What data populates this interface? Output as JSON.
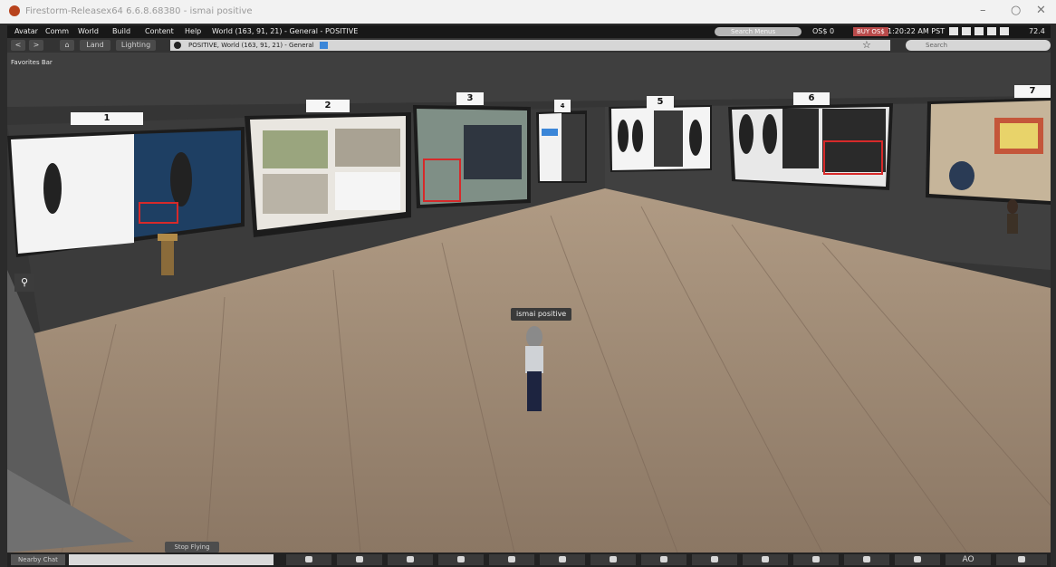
{
  "window": {
    "title": "Firestorm-Releasex64 6.6.8.68380 - ismai positive",
    "minimize": "–",
    "maximize": "○",
    "close": "✕"
  },
  "menubar": {
    "items": [
      "Avatar",
      "Comm",
      "World",
      "Build",
      "Content",
      "Help"
    ],
    "location_text": "World (163, 91, 21) - General - POSITIVE",
    "search_menus_placeholder": "Search Menus",
    "balance": "OS$ 0",
    "buy_label": "BUY OS$",
    "time": "1:20:22 AM PST",
    "fps": "72.4"
  },
  "navbar": {
    "back": "<",
    "forward": ">",
    "home": "⌂",
    "land": "Land",
    "lighting": "Lighting",
    "location": "POSITIVE, World (163, 91, 21) - General",
    "search_placeholder": "Search"
  },
  "favorites_bar": "Favorites Bar",
  "scene": {
    "avatar_name": "ismai positive",
    "panel_numbers": [
      "1",
      "2",
      "3",
      "4",
      "5",
      "6",
      "7"
    ]
  },
  "stop_flying": "Stop Flying",
  "bottombar": {
    "nearby_chat": "Nearby Chat",
    "ao_label": "AO"
  },
  "colors": {
    "floor": "#9f8b76",
    "wall": "#393939",
    "buy_button": "#b94a4a",
    "location_badge": "#3b86d8",
    "slide_marker": "#d62a2a"
  }
}
